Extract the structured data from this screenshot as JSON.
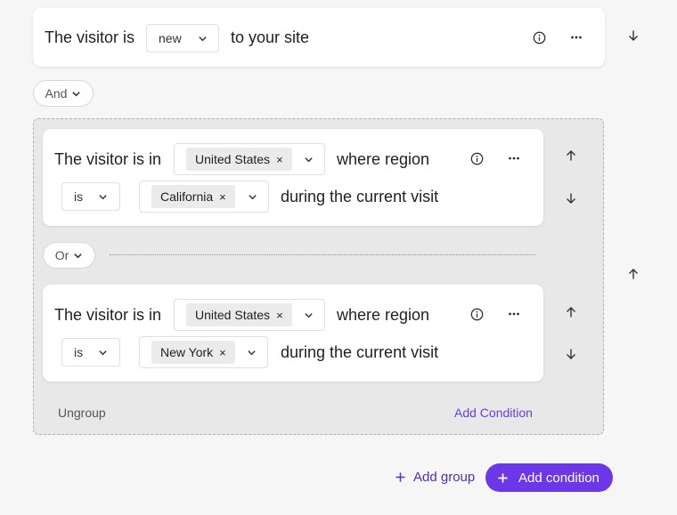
{
  "top_rule": {
    "prefix": "The visitor is",
    "select_value": "new",
    "suffix": "to your site"
  },
  "and_operator": "And",
  "or_operator": "Or",
  "conditions": [
    {
      "prefix": "The visitor is in",
      "country": "United States",
      "middle": "where region",
      "operator": "is",
      "region": "California",
      "suffix": "during the current visit"
    },
    {
      "prefix": "The visitor is in",
      "country": "United States",
      "middle": "where region",
      "operator": "is",
      "region": "New York",
      "suffix": "during the current visit"
    }
  ],
  "group_footer": {
    "ungroup": "Ungroup",
    "add_condition": "Add Condition"
  },
  "footer": {
    "add_group": "Add group",
    "add_condition": "Add condition"
  },
  "icons": {
    "remove": "×"
  },
  "colors": {
    "accent": "#6b37e9",
    "link": "#6a3fd9"
  }
}
